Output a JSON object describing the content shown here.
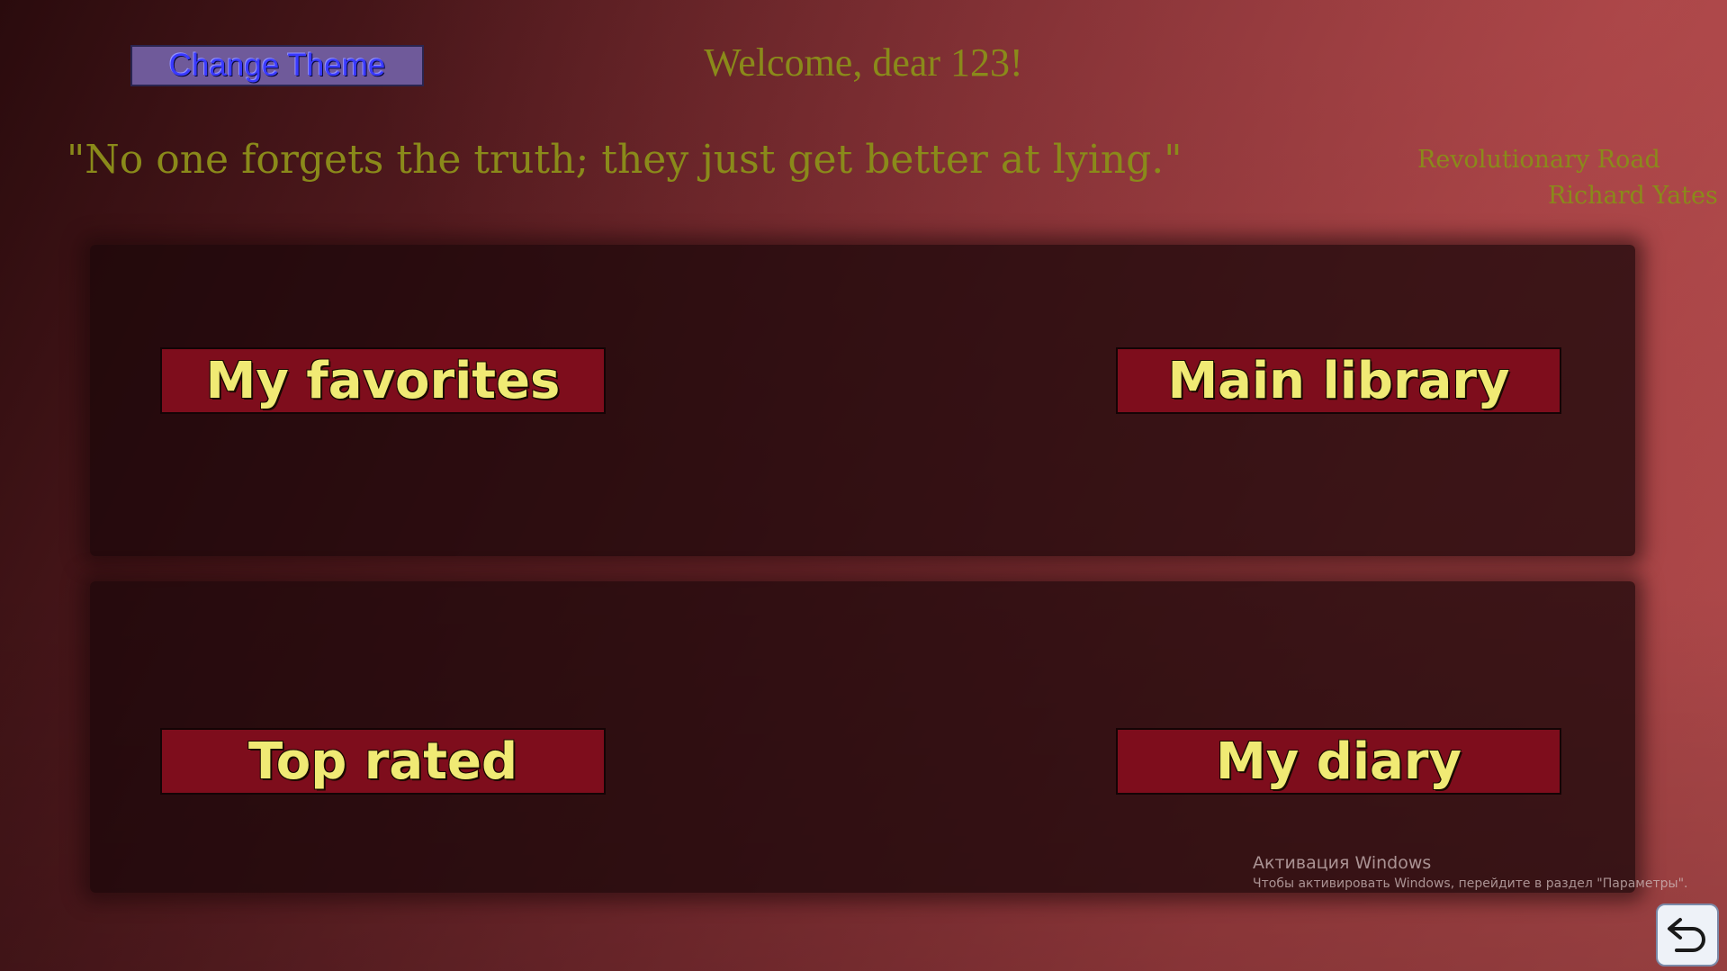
{
  "header": {
    "theme_button_label": "Change Theme",
    "welcome_text": "Welcome, dear 123!"
  },
  "quote": {
    "text": "\"No one forgets the truth; they just get better at lying.\"",
    "book_title": "Revolutionary Road",
    "author": "Richard Yates"
  },
  "nav": {
    "favorites_label": "My favorites",
    "library_label": "Main library",
    "top_rated_label": "Top rated",
    "diary_label": "My diary"
  },
  "system": {
    "activation_title": "Активация Windows",
    "activation_text": "Чтобы активировать Windows, перейдите в раздел \"Параметры\"."
  },
  "icons": {
    "back": "undo-arrow-icon"
  },
  "colors": {
    "accent_text": "#8a8a1a",
    "button_bg": "#7e0d1c",
    "button_text": "#f0ea74",
    "theme_button_bg": "#6f5a9a",
    "theme_button_text": "#3a3aff"
  }
}
